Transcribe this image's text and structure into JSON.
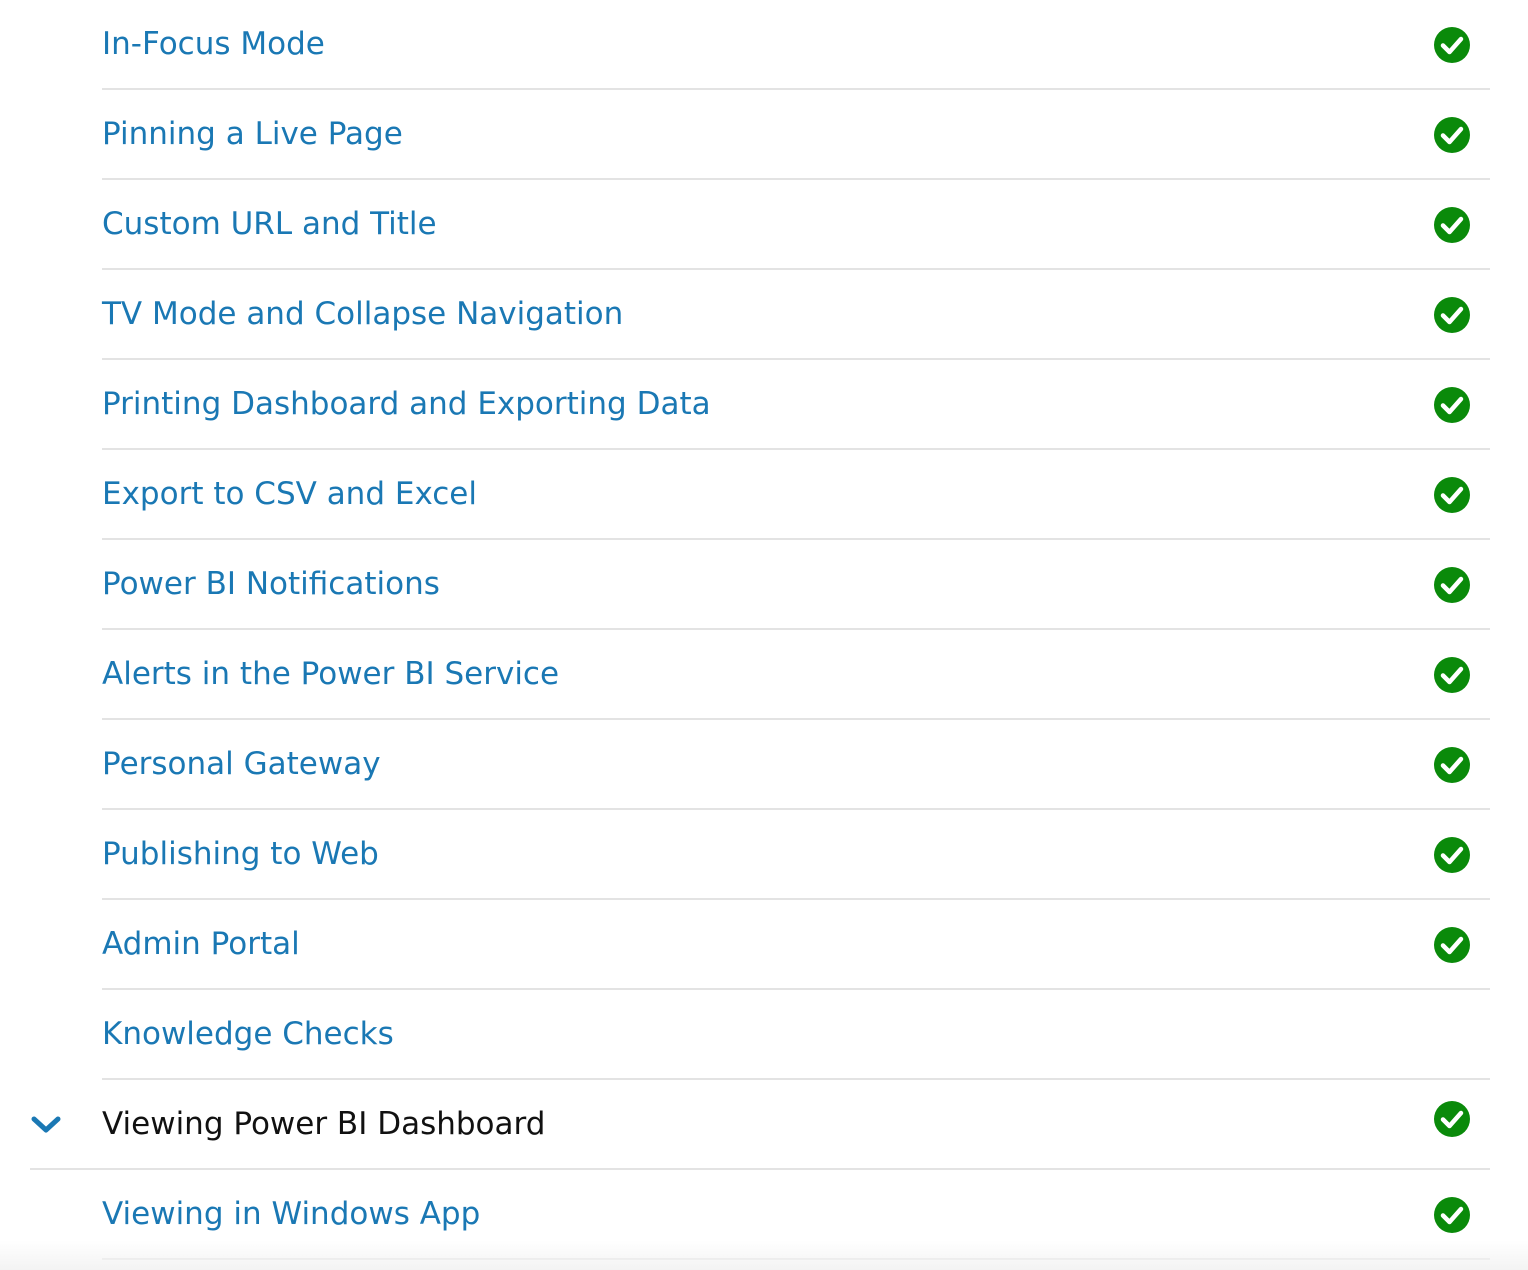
{
  "lessons": [
    {
      "label": "In-Focus Mode",
      "completed": true
    },
    {
      "label": "Pinning a Live Page",
      "completed": true
    },
    {
      "label": "Custom URL and Title",
      "completed": true
    },
    {
      "label": "TV Mode and Collapse Navigation",
      "completed": true
    },
    {
      "label": "Printing Dashboard and Exporting Data",
      "completed": true
    },
    {
      "label": "Export to CSV and Excel",
      "completed": true
    },
    {
      "label": "Power BI Notifications",
      "completed": true
    },
    {
      "label": "Alerts in the Power BI Service",
      "completed": true
    },
    {
      "label": "Personal Gateway",
      "completed": true
    },
    {
      "label": "Publishing to Web",
      "completed": true
    },
    {
      "label": "Admin Portal",
      "completed": true
    },
    {
      "label": "Knowledge Checks",
      "completed": false
    }
  ],
  "section": {
    "label": "Viewing Power BI Dashboard",
    "completed": true,
    "expanded": true,
    "icon": "chevron-down-icon"
  },
  "section_lessons": [
    {
      "label": "Viewing in Windows App",
      "completed": true
    }
  ],
  "colors": {
    "link": "#1a78b4",
    "heading": "#111111",
    "check": "#0a8a0a",
    "divider": "#e3e3e3"
  }
}
